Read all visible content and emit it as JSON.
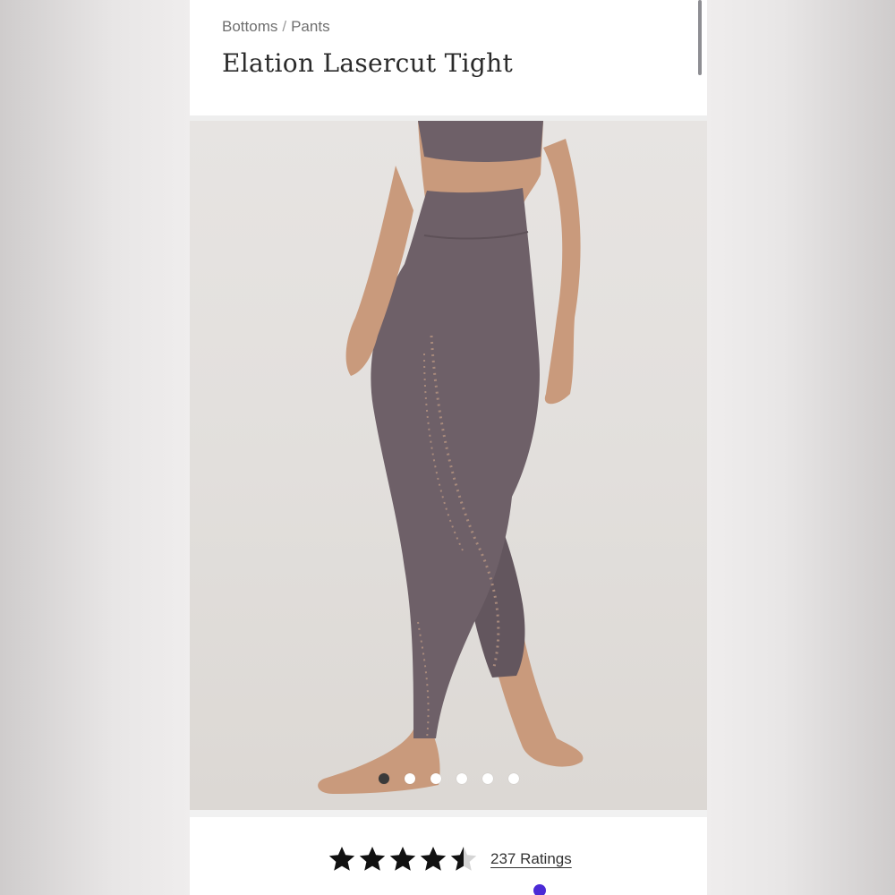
{
  "breadcrumb": {
    "items": [
      "Bottoms",
      "Pants"
    ],
    "separator": "/"
  },
  "product": {
    "title": "Elation Lasercut Tight",
    "rating": {
      "value": 4.5,
      "max": 5,
      "count_label": "237 Ratings"
    }
  },
  "gallery": {
    "total_images": 6,
    "active_index": 0
  },
  "colors": {
    "legging": "#6e6068",
    "skin": "#c99a7c",
    "active_dot": "#3a3a3a",
    "accent": "#4b2ad6"
  },
  "icons": {
    "star": "star-icon",
    "half_star": "half-star-icon"
  }
}
